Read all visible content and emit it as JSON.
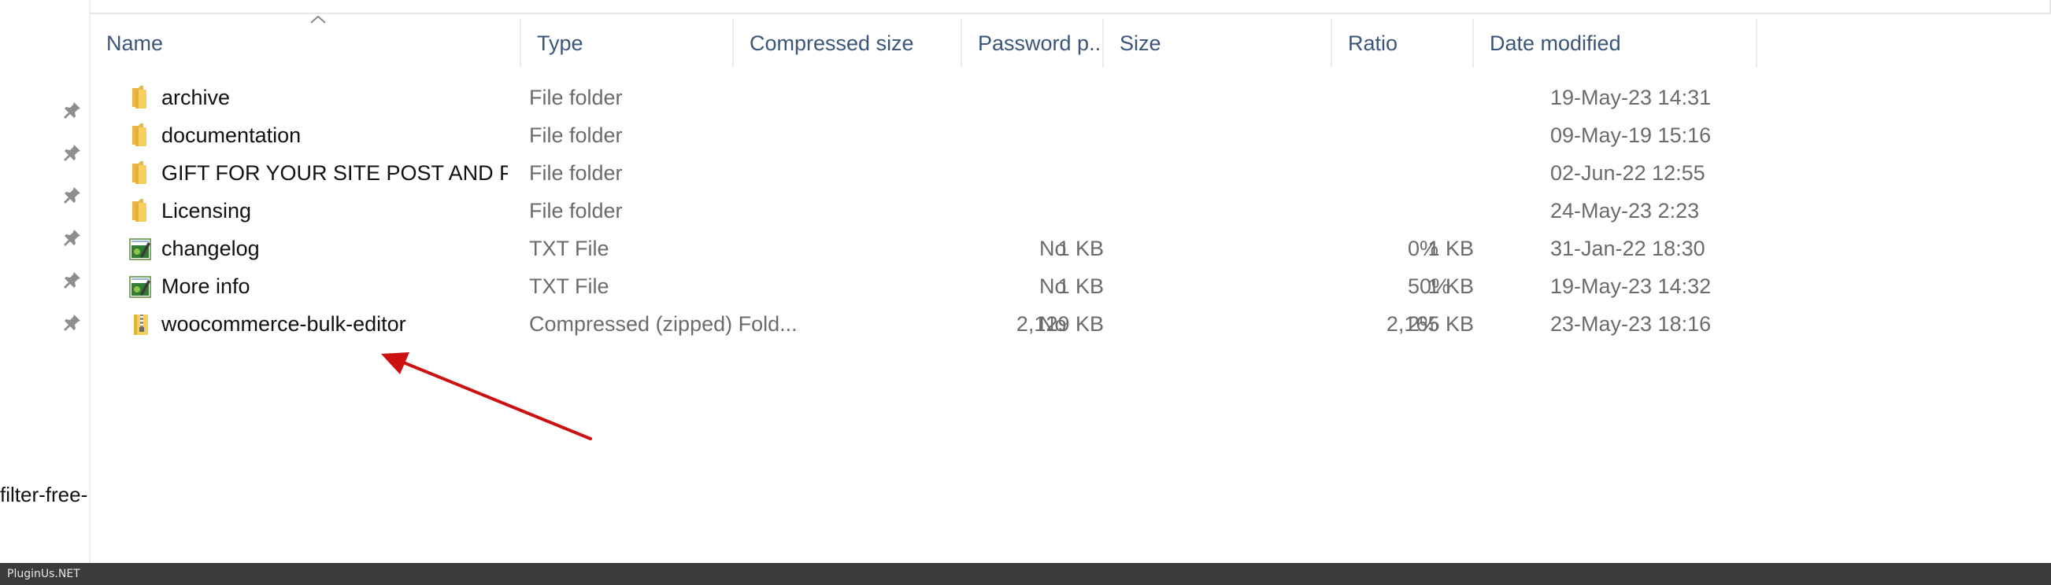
{
  "columns": {
    "name": "Name",
    "type": "Type",
    "compressed_size": "Compressed size",
    "password": "Password p...",
    "size": "Size",
    "ratio": "Ratio",
    "date_modified": "Date modified"
  },
  "files": [
    {
      "name": "archive",
      "type": "File folder",
      "compressed_size": "",
      "password": "",
      "size": "",
      "ratio": "",
      "date": "19-May-23 14:31",
      "icon": "folder-icon"
    },
    {
      "name": "documentation",
      "type": "File folder",
      "compressed_size": "",
      "password": "",
      "size": "",
      "ratio": "",
      "date": "09-May-19 15:16",
      "icon": "folder-icon"
    },
    {
      "name": "GIFT FOR YOUR SITE POST AND PA...",
      "type": "File folder",
      "compressed_size": "",
      "password": "",
      "size": "",
      "ratio": "",
      "date": "02-Jun-22 12:55",
      "icon": "folder-icon"
    },
    {
      "name": "Licensing",
      "type": "File folder",
      "compressed_size": "",
      "password": "",
      "size": "",
      "ratio": "",
      "date": "24-May-23 2:23",
      "icon": "folder-icon"
    },
    {
      "name": "changelog",
      "type": "TXT File",
      "compressed_size": "1 KB",
      "password": "No",
      "size": "1 KB",
      "ratio": "0%",
      "date": "31-Jan-22 18:30",
      "icon": "text-file-icon"
    },
    {
      "name": "More info",
      "type": "TXT File",
      "compressed_size": "1 KB",
      "password": "No",
      "size": "1 KB",
      "ratio": "50%",
      "date": "19-May-23 14:32",
      "icon": "text-file-icon"
    },
    {
      "name": "woocommerce-bulk-editor",
      "type": "Compressed (zipped) Fold...",
      "compressed_size": "2,129 KB",
      "password": "No",
      "size": "2,165 KB",
      "ratio": "2%",
      "date": "23-May-23 18:16",
      "icon": "zip-folder-icon"
    }
  ],
  "nav": {
    "pin_count": 6,
    "truncated_item": "-filter-free"
  },
  "footer": {
    "watermark": "PluginUs.NET"
  },
  "colors": {
    "header_text": "#3b5578",
    "secondary_text": "#6b6b6b",
    "annotation_arrow": "#cc1111",
    "footer_bg": "#3b3b3b"
  }
}
